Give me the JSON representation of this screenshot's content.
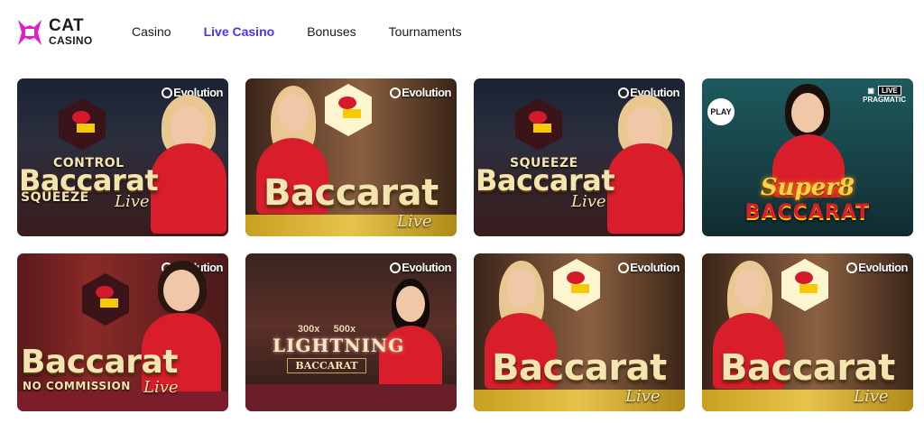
{
  "brand": {
    "line1": "CAT",
    "line2": "CASINO",
    "accent": "#e020c8"
  },
  "nav": [
    {
      "label": "Casino",
      "active": false
    },
    {
      "label": "Live Casino",
      "active": true
    },
    {
      "label": "Bonuses",
      "active": false
    },
    {
      "label": "Tournaments",
      "active": false
    }
  ],
  "active_color": "#4b35e8",
  "tiles": [
    {
      "provider": "Evolution",
      "title": "Baccarat",
      "top_text": "CONTROL",
      "bottom_text": "SQUEEZE",
      "live": "Live"
    },
    {
      "provider": "Evolution",
      "title": "Baccarat",
      "live": "Live"
    },
    {
      "provider": "Evolution",
      "title": "Baccarat",
      "top_text": "SQUEEZE",
      "live": "Live"
    },
    {
      "provider": "PRAGMATIC",
      "badge": "PLAY",
      "live_badge": "LIVE",
      "title_top": "Super8",
      "title": "BACCARAT"
    },
    {
      "provider": "Evolution",
      "title": "Baccarat",
      "bottom_text": "NO COMMISSION",
      "live": "Live"
    },
    {
      "provider": "Evolution",
      "multiplier_1": "300x",
      "multiplier_2": "500x",
      "title_top": "LIGHTNING",
      "title": "BACCARAT"
    },
    {
      "provider": "Evolution",
      "title": "Baccarat",
      "live": "Live"
    },
    {
      "provider": "Evolution",
      "title": "Baccarat",
      "live": "Live"
    }
  ]
}
